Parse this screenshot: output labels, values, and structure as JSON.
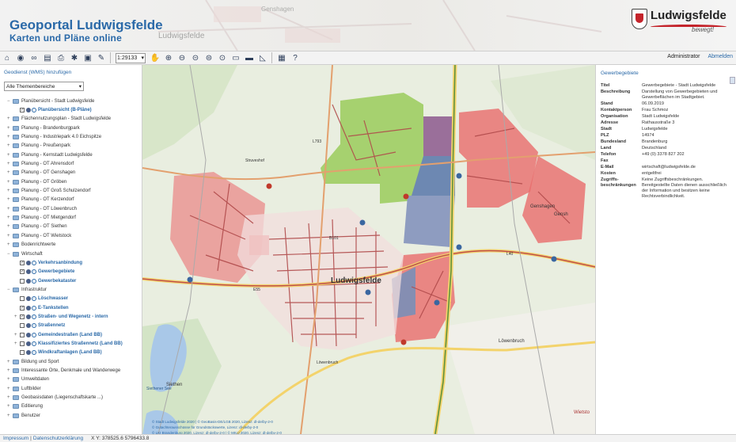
{
  "header": {
    "title": "Geoportal Ludwigsfelde",
    "subtitle": "Karten und Pläne online",
    "logo_name": "Ludwigsfelde",
    "logo_tagline": "bewegt!",
    "background_labels": [
      "Genshagen",
      "Ludwigsfelde"
    ]
  },
  "toolbar": {
    "icons": [
      "home-icon",
      "eye-icon",
      "binoculars-icon",
      "layers-icon",
      "print-icon",
      "settings-icon",
      "image-icon",
      "pencil-icon",
      "pan-hand-icon",
      "zoom-in-icon",
      "zoom-out-icon",
      "zoom-prev-icon",
      "zoom-next-icon",
      "zoom-full-icon",
      "measure-line-icon",
      "measure-area-icon",
      "measure-angle-icon",
      "save-icon",
      "help-icon"
    ],
    "scale": "1:29133",
    "user": "Administrator",
    "logout": "Abmelden"
  },
  "left_panel": {
    "add_wms": "Geodienst (WMS) hinzufügen",
    "theme_select": "Alle Themenbereiche",
    "tree": [
      {
        "label": "Planübersicht - Stadt Ludwigsfelde",
        "level": 0,
        "expand": "−",
        "kind": "folder"
      },
      {
        "label": "Planübersicht (B-Pläne)",
        "level": 1,
        "kind": "layer",
        "checked": true,
        "blue": true
      },
      {
        "label": "Flächennutzungsplan - Stadt Ludwigsfelde",
        "level": 0,
        "expand": "+",
        "kind": "folder"
      },
      {
        "label": "Planung - Brandenburgpark",
        "level": 0,
        "expand": "+",
        "kind": "folder"
      },
      {
        "label": "Planung - Industriepark 4.0 Eichspitze",
        "level": 0,
        "expand": "+",
        "kind": "folder"
      },
      {
        "label": "Planung - Preußenpark",
        "level": 0,
        "expand": "+",
        "kind": "folder"
      },
      {
        "label": "Planung - Kernstadt Ludwigsfelde",
        "level": 0,
        "expand": "+",
        "kind": "folder"
      },
      {
        "label": "Planung - OT Ahrensdorf",
        "level": 0,
        "expand": "+",
        "kind": "folder"
      },
      {
        "label": "Planung - OT Genshagen",
        "level": 0,
        "expand": "+",
        "kind": "folder"
      },
      {
        "label": "Planung - OT Gröben",
        "level": 0,
        "expand": "+",
        "kind": "folder"
      },
      {
        "label": "Planung - OT Groß Schulzendorf",
        "level": 0,
        "expand": "+",
        "kind": "folder"
      },
      {
        "label": "Planung - OT Kerzendorf",
        "level": 0,
        "expand": "+",
        "kind": "folder"
      },
      {
        "label": "Planung - OT Löwenbruch",
        "level": 0,
        "expand": "+",
        "kind": "folder"
      },
      {
        "label": "Planung - OT Mietgendorf",
        "level": 0,
        "expand": "+",
        "kind": "folder"
      },
      {
        "label": "Planung - OT Siethen",
        "level": 0,
        "expand": "+",
        "kind": "folder"
      },
      {
        "label": "Planung - OT Wietstock",
        "level": 0,
        "expand": "+",
        "kind": "folder"
      },
      {
        "label": "Bodenrichtwerte",
        "level": 0,
        "expand": "+",
        "kind": "folder"
      },
      {
        "label": "Wirtschaft",
        "level": 0,
        "expand": "−",
        "kind": "folder"
      },
      {
        "label": "Verkehrsanbindung",
        "level": 1,
        "kind": "layer",
        "checked": true,
        "blue": true
      },
      {
        "label": "Gewerbegebiete",
        "level": 1,
        "kind": "layer",
        "checked": true,
        "blue": true
      },
      {
        "label": "Gewerbekataster",
        "level": 1,
        "kind": "layer",
        "checked": false,
        "blue": true
      },
      {
        "label": "Infrastruktur",
        "level": 0,
        "expand": "−",
        "kind": "folder"
      },
      {
        "label": "Löschwasser",
        "level": 1,
        "kind": "layer",
        "checked": false,
        "blue": true
      },
      {
        "label": "E-Tankstellen",
        "level": 1,
        "kind": "layer",
        "checked": true,
        "blue": true
      },
      {
        "label": "Straßen- und Wegenetz - intern",
        "level": 1,
        "kind": "layer",
        "checked": true,
        "blue": true,
        "expand": "+"
      },
      {
        "label": "Straßennetz",
        "level": 1,
        "kind": "layer",
        "checked": false,
        "blue": true
      },
      {
        "label": "Gemeindestraßen (Land BB)",
        "level": 1,
        "kind": "layer",
        "checked": false,
        "blue": true,
        "expand": "+"
      },
      {
        "label": "Klassifiziertes Straßennetz (Land BB)",
        "level": 1,
        "kind": "layer",
        "checked": false,
        "blue": true,
        "expand": "+"
      },
      {
        "label": "Windkraftanlagen (Land BB)",
        "level": 1,
        "kind": "layer",
        "checked": false,
        "blue": true
      },
      {
        "label": "Bildung und Sport",
        "level": 0,
        "expand": "+",
        "kind": "folder"
      },
      {
        "label": "Interessante Orte, Denkmale und Wanderwege",
        "level": 0,
        "expand": "+",
        "kind": "folder"
      },
      {
        "label": "Umweltdaten",
        "level": 0,
        "expand": "+",
        "kind": "folder"
      },
      {
        "label": "Luftbilder",
        "level": 0,
        "expand": "+",
        "kind": "folder"
      },
      {
        "label": "Geobasisdaten (Liegenschaftskarte ...)",
        "level": 0,
        "expand": "+",
        "kind": "folder"
      },
      {
        "label": "Editierung",
        "level": 0,
        "expand": "+",
        "kind": "folder"
      },
      {
        "label": "Benutzer",
        "level": 0,
        "expand": "+",
        "kind": "folder"
      }
    ]
  },
  "map": {
    "labels": [
      "Ludwigsfelde",
      "Genshagen",
      "Löwenbruch",
      "Siethen",
      "Wietsto",
      "Struveshof",
      "Siethener See",
      "Gensh",
      "Löwenbruch"
    ],
    "road_labels": [
      "L793",
      "L40",
      "E55",
      "B101"
    ],
    "colors": {
      "green_area": "#9acb5b",
      "red_area": "#e86b6b",
      "blue_area": "#6d88b2",
      "purple_area": "#9a6f9a",
      "road_main": "#c0504d",
      "road_yellow": "#f3d36b",
      "background": "#e9eee0",
      "forest": "#cfe0bd"
    },
    "attribution": [
      "© Stadt Ludwigsfelde 2020 | © GeoBasis-DE/LGB 2020, Lizenz: dl-de/by-2-0",
      "© Gutachterausschüsse für Grundstückswerte, Lizenz: dl-de/by-2-0",
      "© LKI Brandenburg 2020, Lizenz: dl-de/by-2-0 | © MIUJ 2020, Lizenz: dl-de/by-2-0",
      "© LS Brandenburg 2020, Lizenz: dl-de/by-2-0 | © BLDAM 2020, Lizenz: dl-de/by-2-0 | © OpenStreetMap 2020, Lizenz: CC BY 2.0"
    ]
  },
  "right_panel": {
    "title": "Gewerbegebiete",
    "rows": [
      {
        "k": "Titel",
        "v": "Gewerbegebiete - Stadt Ludwigsfelde"
      },
      {
        "k": "Beschreibung",
        "v": "Darstellung von Gewerbegebieten und Gewerbeflächen im Stadtgebiet."
      },
      {
        "k": "Stand",
        "v": "06.09.2019"
      },
      {
        "k": "Kontaktperson",
        "v": "Frau Schmoz"
      },
      {
        "k": "Organisation",
        "v": "Stadt Ludwigsfelde"
      },
      {
        "k": "Adresse",
        "v": "Rathausstraße 3"
      },
      {
        "k": "Stadt",
        "v": "Ludwigsfelde"
      },
      {
        "k": "PLZ",
        "v": "14974"
      },
      {
        "k": "Bundesland",
        "v": "Brandenburg"
      },
      {
        "k": "Land",
        "v": "Deutschland"
      },
      {
        "k": "Telefon",
        "v": "+49 (0) 3378 827 202"
      },
      {
        "k": "Fax",
        "v": ""
      },
      {
        "k": "E-Mail",
        "v": "wirtschaft@ludwigsfelde.de"
      },
      {
        "k": "Kosten",
        "v": "entgeltfrei"
      },
      {
        "k": "Zugriffs-beschränkungen",
        "v": "Keine Zugriffsbeschränkungen. Bereitgestellte Daten dienen ausschließlich der Information und besitzen keine Rechtsverbindlichkeit."
      }
    ]
  },
  "footer": {
    "impressum": "Impressum",
    "separator": "|",
    "datenschutz": "Datenschutzerklärung",
    "coordinates": "X Y: 378525.6  5796433.8"
  }
}
